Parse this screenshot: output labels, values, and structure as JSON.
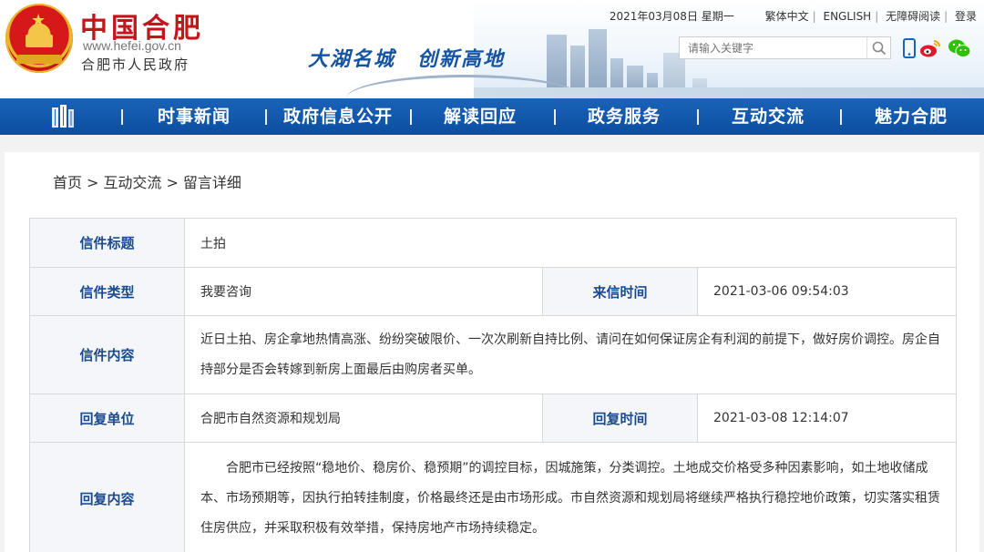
{
  "header": {
    "site_title": "中国合肥",
    "site_url": "www.hefei.gov.cn",
    "site_subtitle": "合肥市人民政府",
    "slogan": "大湖名城　创新高地",
    "date": "2021年03月08日 星期一",
    "links": [
      "繁体中文",
      "ENGLISH",
      "无障碍阅读",
      "登录"
    ],
    "search_placeholder": "请输入关键字"
  },
  "nav": {
    "items": [
      "时事新闻",
      "政府信息公开",
      "解读回应",
      "政务服务",
      "互动交流",
      "魅力合肥"
    ]
  },
  "breadcrumb": {
    "items": [
      "首页",
      ">",
      "互动交流",
      ">",
      "留言详细"
    ]
  },
  "letter": {
    "title_label": "信件标题",
    "title_value": "土拍",
    "type_label": "信件类型",
    "type_value": "我要咨询",
    "sent_time_label": "来信时间",
    "sent_time_value": "2021-03-06 09:54:03",
    "content_label": "信件内容",
    "content_value": "近日土拍、房企拿地热情高涨、纷纷突破限价、一次次刷新自持比例、请问在如何保证房企有利润的前提下，做好房价调控。房企自持部分是否会转嫁到新房上面最后由购房者买单。",
    "reply_unit_label": "回复单位",
    "reply_unit_value": "合肥市自然资源和规划局",
    "reply_time_label": "回复时间",
    "reply_time_value": "2021-03-08 12:14:07",
    "reply_content_label": "回复内容",
    "reply_content_value": "　　合肥市已经按照“稳地价、稳房价、稳预期”的调控目标，因城施策，分类调控。土地成交价格受多种因素影响，如土地收储成本、市场预期等，因执行拍转挂制度，价格最终还是由市场形成。市自然资源和规划局将继续严格执行稳控地价政策，切实落实租赁住房供应，并采取积极有效举措，保持房地产市场持续稳定。"
  },
  "colors": {
    "nav_blue": "#1259ab",
    "title_red": "#c3151b",
    "label_blue": "#1a4b8e",
    "slogan_blue": "#1553a3"
  }
}
